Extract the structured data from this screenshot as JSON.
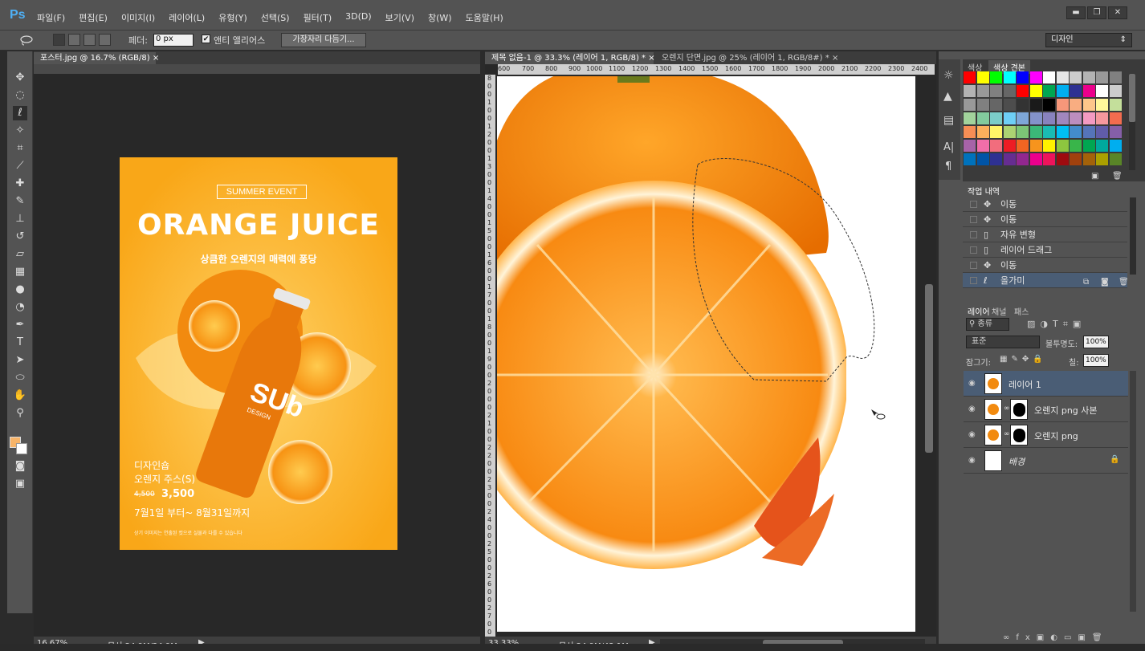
{
  "app": {
    "logo": "Ps"
  },
  "menu": [
    "파일(F)",
    "편집(E)",
    "이미지(I)",
    "레이어(L)",
    "유형(Y)",
    "선택(S)",
    "필터(T)",
    "3D(D)",
    "보기(V)",
    "창(W)",
    "도움말(H)"
  ],
  "window_controls": {
    "minimize": "▬",
    "restore": "❐",
    "close": "✕"
  },
  "options": {
    "feather_label": "페더:",
    "feather_value": "0 px",
    "antialias_label": "앤티 앨리어스",
    "antialias_check": "✔",
    "refine_button": "가장자리 다듬기...",
    "workspace": "디자인"
  },
  "doc1": {
    "tab": "포스터.jpg @ 16.7% (RGB/8)",
    "tab_close": "×",
    "zoom": "16.67%",
    "status": "문서:24.9M/24.9M"
  },
  "poster": {
    "event": "SUMMER EVENT",
    "title": "ORANGE JUICE",
    "subtitle": "상큼한 오렌지의 매력에 퐁당",
    "brand": "SUb",
    "brand_small": "DESIGN",
    "product_line1": "디자인숍",
    "product_line2": "오렌지 주스(S)",
    "old_price": "4,500",
    "price": "3,500",
    "period": "7월1일 부터~ 8월31일까지",
    "note": "상기 이미지는 연출된 컷으로 실물과 다를 수 있습니다"
  },
  "doc2": {
    "tab_active": "제목 없음-1 @ 33.3% (레이어 1, RGB/8) *",
    "tab_other": "오렌지 단면.jpg @ 25% (레이어 1, RGB/8#) *",
    "tab_close": "×",
    "zoom": "33.33%",
    "status": "문서:24.9M/42.1M",
    "ruler_top": [
      "600",
      "700",
      "800",
      "900",
      "1000",
      "1100",
      "1200",
      "1300",
      "1400",
      "1500",
      "1600",
      "1700",
      "1800",
      "1900",
      "2000",
      "2100",
      "2200",
      "2300",
      "2400"
    ],
    "ruler_left": [
      "8",
      "0",
      "0",
      "1",
      "0",
      "0",
      "1",
      "2",
      "0",
      "0",
      "1",
      "3",
      "0",
      "0",
      "1",
      "4",
      "0",
      "0",
      "1",
      "5",
      "0",
      "0",
      "1",
      "6",
      "0",
      "0",
      "1",
      "7",
      "0",
      "0",
      "1",
      "8",
      "0",
      "0",
      "1",
      "9",
      "0",
      "0",
      "2",
      "0",
      "0",
      "0",
      "2",
      "1",
      "0",
      "0",
      "2",
      "2",
      "0",
      "0",
      "2",
      "3",
      "0",
      "0",
      "2",
      "4",
      "0",
      "0",
      "2",
      "5",
      "0",
      "0",
      "2",
      "6",
      "0",
      "0",
      "2",
      "7",
      "0",
      "0"
    ]
  },
  "swatch_panel": {
    "tabs": [
      "색상",
      "색상 견본"
    ]
  },
  "history_panel": {
    "title": "작업 내역",
    "items": [
      {
        "label": "이동",
        "icon": "move-icon"
      },
      {
        "label": "이동",
        "icon": "move-icon"
      },
      {
        "label": "자유 변형",
        "icon": "doc-icon"
      },
      {
        "label": "레이어 드래그",
        "icon": "doc-icon"
      },
      {
        "label": "이동",
        "icon": "move-icon"
      },
      {
        "label": "올가미",
        "icon": "lasso-icon"
      }
    ]
  },
  "layers_panel": {
    "tabs": [
      "레이어",
      "채널",
      "패스"
    ],
    "filter": "종류",
    "blend_mode": "표준",
    "opacity_label": "불투명도:",
    "opacity": "100%",
    "lock_label": "잠그기:",
    "fill_label": "칠:",
    "fill": "100%",
    "layers": [
      {
        "name": "레이어 1",
        "selected": true,
        "mask": false
      },
      {
        "name": "오렌지 png 사본",
        "selected": false,
        "mask": true
      },
      {
        "name": "오렌지 png",
        "selected": false,
        "mask": true
      },
      {
        "name": "배경",
        "selected": false,
        "mask": false,
        "locked": true
      }
    ]
  },
  "colors": {
    "accent": "#4fb0f5",
    "orange": "#fbb62b",
    "selection": "#4a5d75",
    "fg_swatch": "#f7b469"
  }
}
